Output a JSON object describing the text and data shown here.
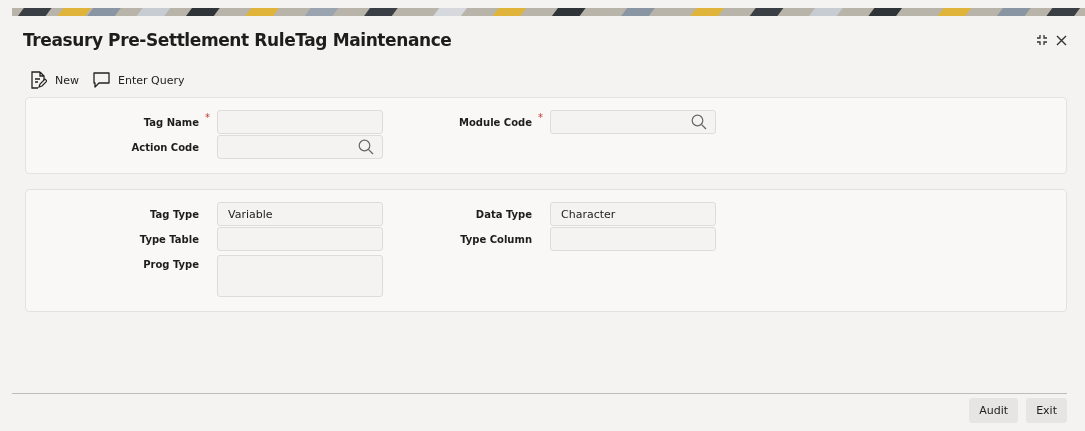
{
  "window": {
    "title": "Treasury Pre-Settlement RuleTag Maintenance"
  },
  "toolbar": [
    {
      "label": "New",
      "kind": "new"
    },
    {
      "label": "Enter Query",
      "kind": "query"
    }
  ],
  "sections": [
    {
      "fields": [
        {
          "label": "Tag Name",
          "required_mark": "*",
          "kind": "text"
        },
        {
          "label": "Module Code",
          "required_mark": "*",
          "kind": "lookup"
        },
        {
          "label": "Action Code",
          "kind": "lookup"
        }
      ]
    },
    {
      "fields": [
        {
          "label": "Tag Type",
          "kind": "text",
          "value": "Variable"
        },
        {
          "label": "Data Type",
          "kind": "text",
          "value": "Character"
        },
        {
          "label": "Type Table",
          "kind": "text"
        },
        {
          "label": "Type Column",
          "kind": "text"
        },
        {
          "label": "Prog Type",
          "kind": "area"
        }
      ]
    }
  ],
  "footer_buttons": [
    "Audit",
    "Exit"
  ]
}
